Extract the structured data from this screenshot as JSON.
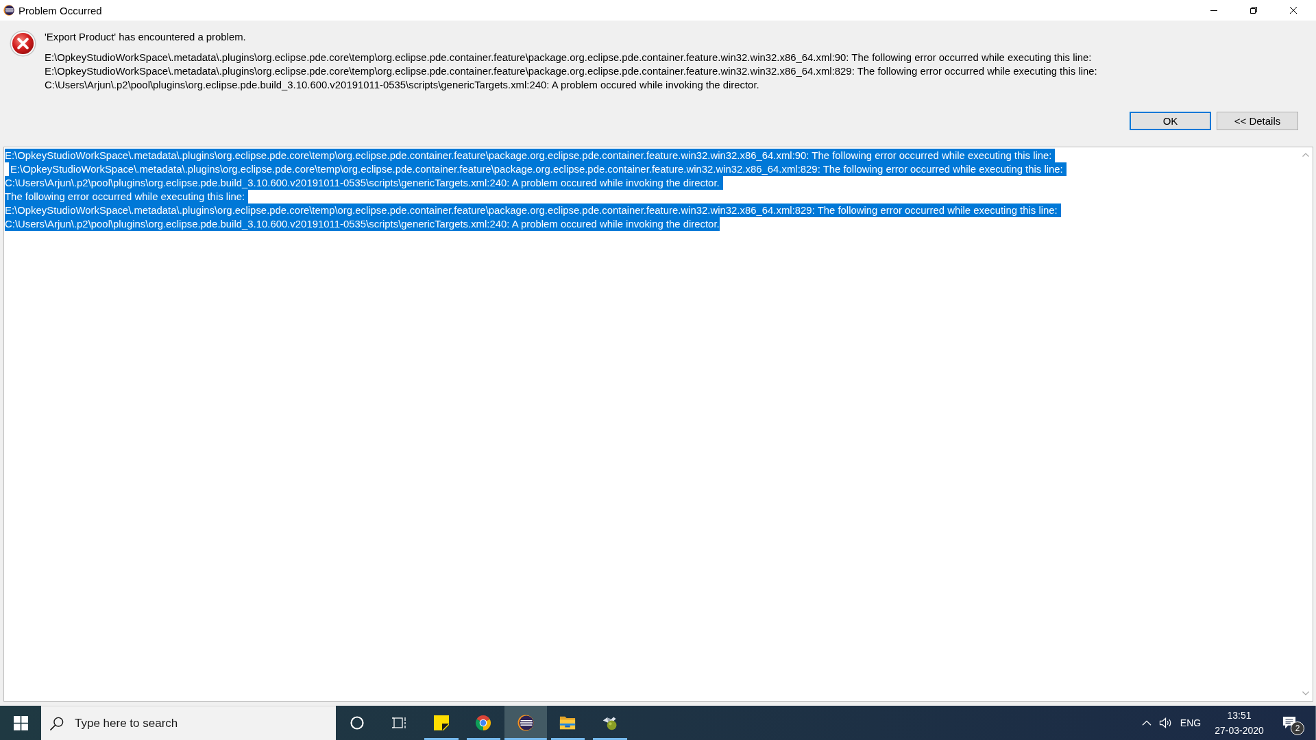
{
  "window": {
    "title": "Problem Occurred"
  },
  "dialog": {
    "heading": "'Export Product' has encountered a problem.",
    "message_lines": [
      "E:\\OpkeyStudioWorkSpace\\.metadata\\.plugins\\org.eclipse.pde.core\\temp\\org.eclipse.pde.container.feature\\package.org.eclipse.pde.container.feature.win32.win32.x86_64.xml:90: The following error occurred while executing this line:",
      "E:\\OpkeyStudioWorkSpace\\.metadata\\.plugins\\org.eclipse.pde.core\\temp\\org.eclipse.pde.container.feature\\package.org.eclipse.pde.container.feature.win32.win32.x86_64.xml:829: The following error occurred while executing this line:",
      "C:\\Users\\Arjun\\.p2\\pool\\plugins\\org.eclipse.pde.build_3.10.600.v20191011-0535\\scripts\\genericTargets.xml:240: A problem occured while invoking the director."
    ],
    "buttons": [
      {
        "label": "OK",
        "default": true
      },
      {
        "label": "<< Details",
        "default": false
      }
    ]
  },
  "details": {
    "lines": [
      {
        "text": "E:\\OpkeyStudioWorkSpace\\.metadata\\.plugins\\org.eclipse.pde.core\\temp\\org.eclipse.pde.container.feature\\package.org.eclipse.pde.container.feature.win32.win32.x86_64.xml:90: The following error occurred while executing this line:",
        "selected": true,
        "indented": false
      },
      {
        "text": "E:\\OpkeyStudioWorkSpace\\.metadata\\.plugins\\org.eclipse.pde.core\\temp\\org.eclipse.pde.container.feature\\package.org.eclipse.pde.container.feature.win32.win32.x86_64.xml:829: The following error occurred while executing this line:",
        "selected": true,
        "indented": true
      },
      {
        "text": "C:\\Users\\Arjun\\.p2\\pool\\plugins\\org.eclipse.pde.build_3.10.600.v20191011-0535\\scripts\\genericTargets.xml:240: A problem occured while invoking the director.",
        "selected": true,
        "indented": false
      },
      {
        "text": "The following error occurred while executing this line:",
        "selected": true,
        "indented": false
      },
      {
        "text": "E:\\OpkeyStudioWorkSpace\\.metadata\\.plugins\\org.eclipse.pde.core\\temp\\org.eclipse.pde.container.feature\\package.org.eclipse.pde.container.feature.win32.win32.x86_64.xml:829: The following error occurred while executing this line:",
        "selected": true,
        "indented": false
      },
      {
        "text": "C:\\Users\\Arjun\\.p2\\pool\\plugins\\org.eclipse.pde.build_3.10.600.v20191011-0535\\scripts\\genericTargets.xml:240: A problem occured while invoking the director.",
        "selected": true,
        "indented": false
      }
    ]
  },
  "taskbar": {
    "search": {
      "placeholder": "Type here to search"
    },
    "apps": [
      {
        "kind": "cortana",
        "running": false,
        "active": false
      },
      {
        "kind": "task-view",
        "running": false,
        "active": false
      },
      {
        "kind": "sticky-notes",
        "running": true,
        "active": false
      },
      {
        "kind": "chrome",
        "running": true,
        "active": false
      },
      {
        "kind": "eclipse",
        "running": true,
        "active": true
      },
      {
        "kind": "file-explorer",
        "running": true,
        "active": false
      },
      {
        "kind": "app",
        "running": true,
        "active": false
      }
    ],
    "tray": {
      "language": "ENG",
      "time": "13:51",
      "date": "27-03-2020",
      "notification_count": "2"
    }
  }
}
